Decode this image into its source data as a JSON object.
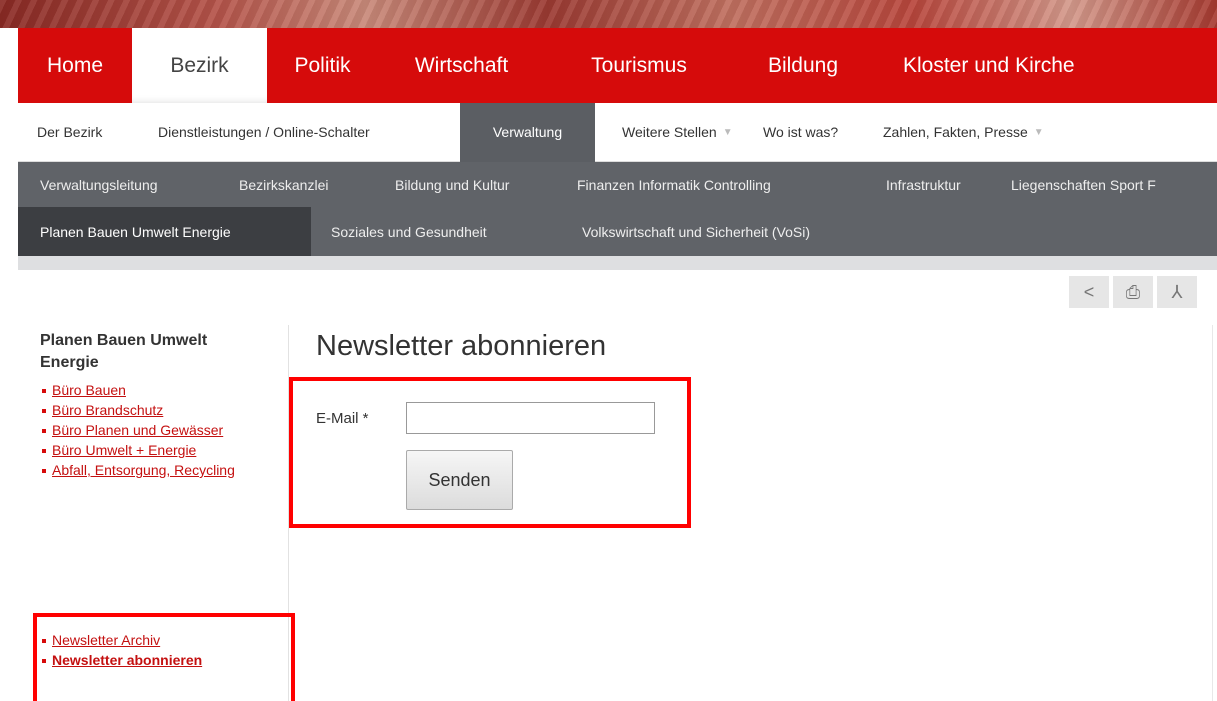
{
  "main_nav": [
    "Home",
    "Bezirk",
    "Politik",
    "Wirtschaft",
    "Tourismus",
    "Bildung",
    "Kloster und Kirche"
  ],
  "sub_nav": {
    "items": [
      "Der Bezirk",
      "Dienstleistungen / Online-Schalter",
      "Verwaltung",
      "Weitere Stellen",
      "Wo ist was?",
      "Zahlen, Fakten, Presse"
    ],
    "dropdown_marker": "▼"
  },
  "third_nav": [
    "Verwaltungsleitung",
    "Bezirkskanzlei",
    "Bildung und Kultur",
    "Finanzen Informatik Controlling",
    "Infrastruktur",
    "Liegenschaften Sport F"
  ],
  "fourth_nav": [
    "Planen Bauen Umwelt Energie",
    "Soziales und Gesundheit",
    "Volkswirtschaft und Sicherheit (VoSi)"
  ],
  "tools": {
    "share": "<",
    "print": "⎙",
    "pdf": "⅄"
  },
  "sidebar": {
    "title": "Planen Bauen Umwelt Energie",
    "links": [
      "Büro Bauen",
      "Büro Brandschutz",
      "Büro Planen und Gewässer",
      "Büro Umwelt + Energie",
      "Abfall, Entsorgung, Recycling"
    ],
    "newsletter_links": [
      "Newsletter Archiv",
      "Newsletter abonnieren"
    ]
  },
  "content": {
    "title": "Newsletter abonnieren",
    "email_label": "E-Mail *",
    "email_value": "",
    "submit_label": "Senden"
  },
  "colors": {
    "brand_red": "#d60b0b",
    "dark_gray": "#606368",
    "highlight": "#ff0000"
  }
}
